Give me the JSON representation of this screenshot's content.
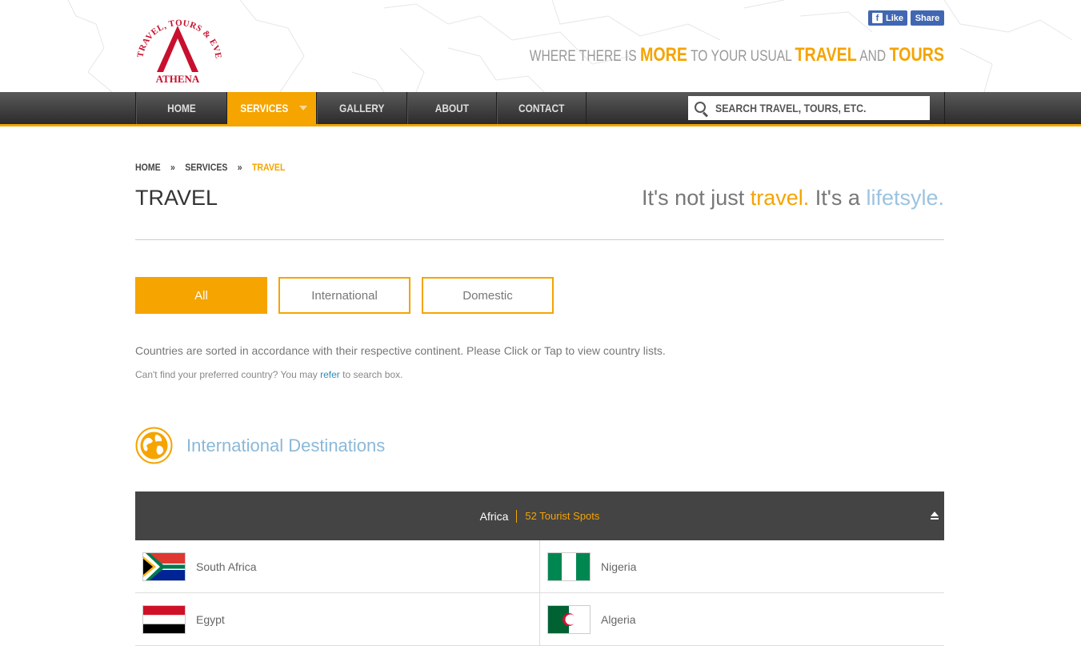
{
  "header": {
    "logo_text": "TRAVEL, TOURS & EVENTS, INC. ATHENA",
    "fb_like": "Like",
    "fb_share": "Share",
    "tagline": {
      "p1": "WHERE THERE IS ",
      "h1": "MORE",
      "p2": " TO YOUR USUAL ",
      "h2": "TRAVEL",
      "p3": " AND ",
      "h3": "TOURS"
    }
  },
  "nav": {
    "items": [
      "HOME",
      "SERVICES",
      "GALLERY",
      "ABOUT",
      "CONTACT"
    ],
    "active": "SERVICES",
    "search_placeholder": "SEARCH TRAVEL, TOURS, ETC."
  },
  "breadcrumb": {
    "items": [
      "HOME",
      "SERVICES",
      "TRAVEL"
    ],
    "separator": "»"
  },
  "page": {
    "title": "TRAVEL",
    "slogan": {
      "p1": "It's not just ",
      "h1": "travel.",
      "p2": " It's a ",
      "h2": "lifetsyle."
    }
  },
  "filters": [
    "All",
    "International",
    "Domestic"
  ],
  "notes": {
    "line1": "Countries are sorted in accordance with their respective continent. Please Click or Tap to view country lists.",
    "line2_pre": "Can't find your preferred country? You may ",
    "line2_link": "refer",
    "line2_post": " to search box."
  },
  "section": {
    "title": "International Destinations"
  },
  "continent": {
    "name": "Africa",
    "spots": "52 Tourist Spots"
  },
  "countries": [
    {
      "name": "South Africa",
      "flag": "south-africa-flag"
    },
    {
      "name": "Nigeria",
      "flag": "nigeria-flag"
    },
    {
      "name": "Egypt",
      "flag": "egypt-flag"
    },
    {
      "name": "Algeria",
      "flag": "algeria-flag"
    }
  ],
  "colors": {
    "accent": "#f5a400",
    "nav_bg": "#3a3a3a",
    "section_blue": "#8bb8d8",
    "link": "#2d8ab8"
  }
}
